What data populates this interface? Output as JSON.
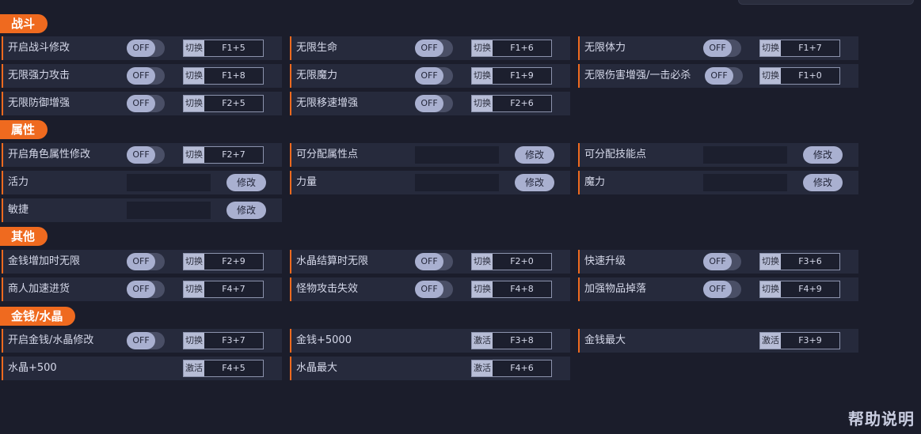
{
  "sections": [
    {
      "title": "战斗"
    },
    {
      "title": "属性"
    },
    {
      "title": "其他"
    },
    {
      "title": "金钱/水晶"
    }
  ],
  "toggle_off": "OFF",
  "switch_label": "切换",
  "activate_label": "激活",
  "modify_label": "修改",
  "help": "帮助说明",
  "battle": [
    {
      "label": "开启战斗修改",
      "key": "F1+5"
    },
    {
      "label": "无限生命",
      "key": "F1+6"
    },
    {
      "label": "无限体力",
      "key": "F1+7"
    },
    {
      "label": "无限强力攻击",
      "key": "F1+8"
    },
    {
      "label": "无限魔力",
      "key": "F1+9"
    },
    {
      "label": "无限伤害增强/一击必杀",
      "key": "F1+0"
    },
    {
      "label": "无限防御增强",
      "key": "F2+5"
    },
    {
      "label": "无限移速增强",
      "key": "F2+6"
    }
  ],
  "attributes": [
    {
      "label": "开启角色属性修改",
      "key": "F2+7"
    },
    {
      "label": "可分配属性点"
    },
    {
      "label": "可分配技能点"
    },
    {
      "label": "活力"
    },
    {
      "label": "力量"
    },
    {
      "label": "魔力"
    },
    {
      "label": "敏捷"
    }
  ],
  "other": [
    {
      "label": "金钱增加时无限",
      "key": "F2+9"
    },
    {
      "label": "水晶结算时无限",
      "key": "F2+0"
    },
    {
      "label": "快速升级",
      "key": "F3+6"
    },
    {
      "label": "商人加速进货",
      "key": "F4+7"
    },
    {
      "label": "怪物攻击失效",
      "key": "F4+8"
    },
    {
      "label": "加强物品掉落",
      "key": "F4+9"
    }
  ],
  "money": [
    {
      "label": "开启金钱/水晶修改",
      "key": "F3+7"
    },
    {
      "label": "金钱+5000",
      "key": "F3+8"
    },
    {
      "label": "金钱最大",
      "key": "F3+9"
    },
    {
      "label": "水晶+500",
      "key": "F4+5"
    },
    {
      "label": "水晶最大",
      "key": "F4+6"
    }
  ]
}
